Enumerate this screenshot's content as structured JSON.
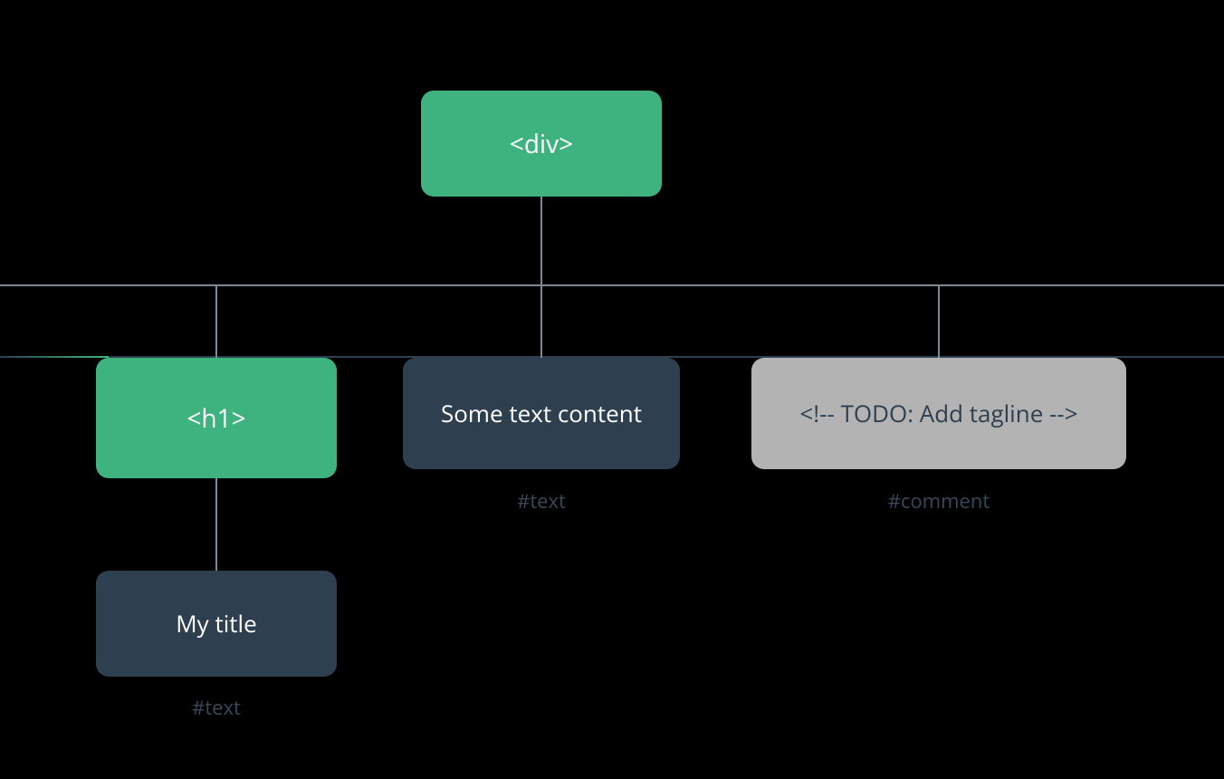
{
  "diagram": {
    "root": {
      "label": "<div>"
    },
    "children": {
      "h1": {
        "label": "<h1>",
        "child": {
          "label": "My title",
          "caption": "#text"
        }
      },
      "text": {
        "label": "Some text content",
        "caption": "#text"
      },
      "comment": {
        "label": "<!-- TODO: Add tagline  -->",
        "caption": "#comment"
      }
    }
  },
  "colors": {
    "element": "#3FB37F",
    "text_node": "#2E3F4F",
    "comment": "#B3B3B3",
    "connector": "#7C8A97"
  }
}
